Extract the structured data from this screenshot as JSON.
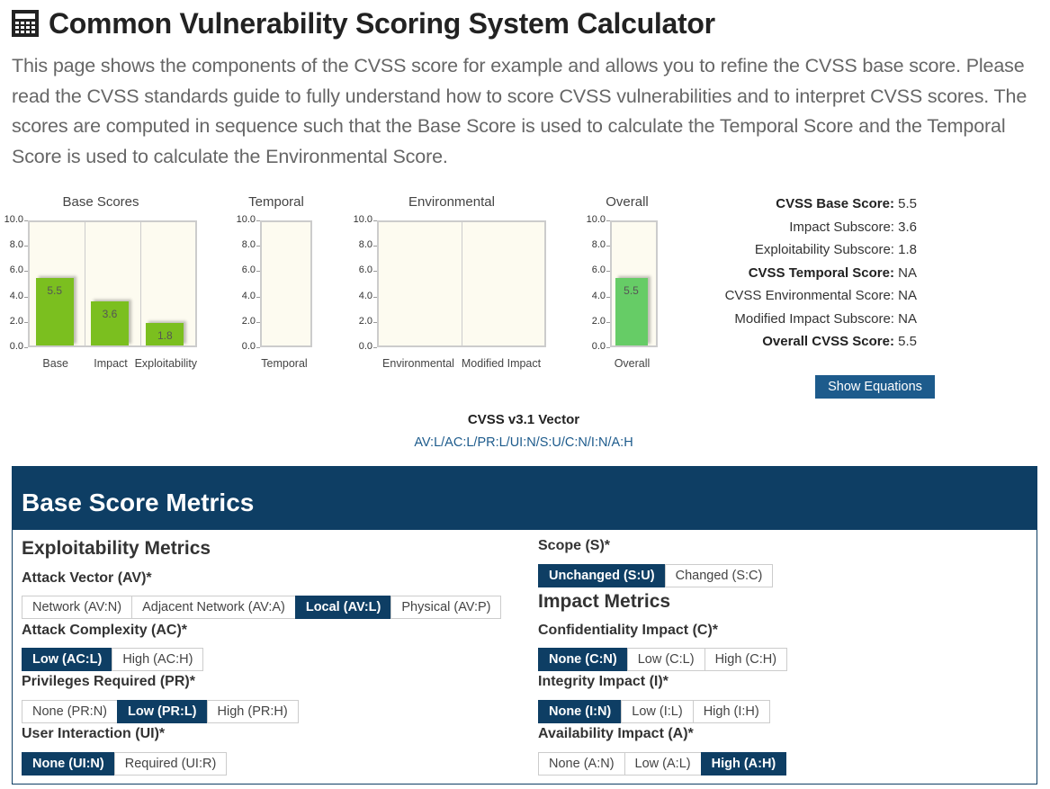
{
  "header": {
    "title": "Common Vulnerability Scoring System Calculator",
    "intro": "This page shows the components of the CVSS score for example and allows you to refine the CVSS base score. Please read the CVSS standards guide to fully understand how to score CVSS vulnerabilities and to interpret CVSS scores. The scores are computed in sequence such that the Base Score is used to calculate the Temporal Score and the Temporal Score is used to calculate the Environmental Score."
  },
  "chart_data": [
    {
      "type": "bar",
      "title": "Base Scores",
      "categories": [
        "Base",
        "Impact",
        "Exploitability"
      ],
      "values": [
        5.5,
        3.6,
        1.8
      ],
      "ylim": [
        0,
        10
      ],
      "yticks": [
        "0.0",
        "2.0",
        "4.0",
        "6.0",
        "8.0",
        "10.0"
      ],
      "color": "#7bbf1f"
    },
    {
      "type": "bar",
      "title": "Temporal",
      "categories": [
        "Temporal"
      ],
      "values": [
        null
      ],
      "ylim": [
        0,
        10
      ],
      "yticks": [
        "0.0",
        "2.0",
        "4.0",
        "6.0",
        "8.0",
        "10.0"
      ]
    },
    {
      "type": "bar",
      "title": "Environmental",
      "categories": [
        "Environmental",
        "Modified Impact"
      ],
      "values": [
        null,
        null
      ],
      "ylim": [
        0,
        10
      ],
      "yticks": [
        "0.0",
        "2.0",
        "4.0",
        "6.0",
        "8.0",
        "10.0"
      ]
    },
    {
      "type": "bar",
      "title": "Overall",
      "categories": [
        "Overall"
      ],
      "values": [
        5.5
      ],
      "ylim": [
        0,
        10
      ],
      "yticks": [
        "0.0",
        "2.0",
        "4.0",
        "6.0",
        "8.0",
        "10.0"
      ],
      "color": "#66cc66"
    }
  ],
  "scores": {
    "base_label": "CVSS Base Score:",
    "base": "5.5",
    "impact_label": "Impact Subscore:",
    "impact": "3.6",
    "exploit_label": "Exploitability Subscore:",
    "exploit": "1.8",
    "temporal_label": "CVSS Temporal Score:",
    "temporal": "NA",
    "env_label": "CVSS Environmental Score:",
    "env": "NA",
    "modimpact_label": "Modified Impact Subscore:",
    "modimpact": "NA",
    "overall_label": "Overall CVSS Score:",
    "overall": "5.5"
  },
  "show_equations": "Show Equations",
  "vector": {
    "title": "CVSS v3.1 Vector",
    "value": "AV:L/AC:L/PR:L/UI:N/S:U/C:N/I:N/A:H"
  },
  "panel": {
    "title": "Base Score Metrics",
    "exploitability_title": "Exploitability Metrics",
    "impact_title": "Impact Metrics",
    "av": {
      "label": "Attack Vector (AV)*",
      "options": [
        "Network (AV:N)",
        "Adjacent Network (AV:A)",
        "Local (AV:L)",
        "Physical (AV:P)"
      ],
      "selected": 2
    },
    "ac": {
      "label": "Attack Complexity (AC)*",
      "options": [
        "Low (AC:L)",
        "High (AC:H)"
      ],
      "selected": 0
    },
    "pr": {
      "label": "Privileges Required (PR)*",
      "options": [
        "None (PR:N)",
        "Low (PR:L)",
        "High (PR:H)"
      ],
      "selected": 1
    },
    "ui": {
      "label": "User Interaction (UI)*",
      "options": [
        "None (UI:N)",
        "Required (UI:R)"
      ],
      "selected": 0
    },
    "s": {
      "label": "Scope (S)*",
      "options": [
        "Unchanged (S:U)",
        "Changed (S:C)"
      ],
      "selected": 0
    },
    "c": {
      "label": "Confidentiality Impact (C)*",
      "options": [
        "None (C:N)",
        "Low (C:L)",
        "High (C:H)"
      ],
      "selected": 0
    },
    "i": {
      "label": "Integrity Impact (I)*",
      "options": [
        "None (I:N)",
        "Low (I:L)",
        "High (I:H)"
      ],
      "selected": 0
    },
    "a": {
      "label": "Availability Impact (A)*",
      "options": [
        "None (A:N)",
        "Low (A:L)",
        "High (A:H)"
      ],
      "selected": 2
    }
  }
}
